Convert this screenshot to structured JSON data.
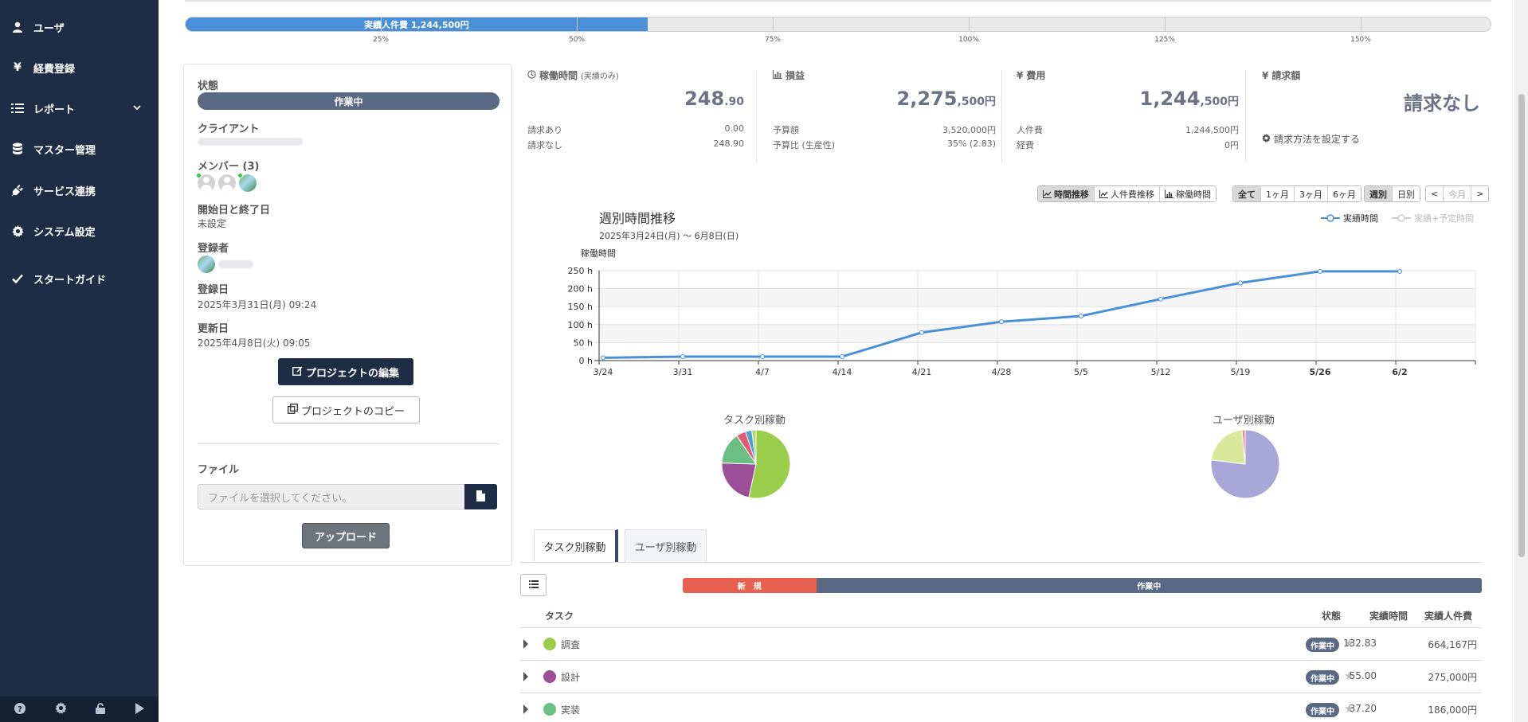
{
  "sidebar": {
    "items": [
      {
        "label": "ユーザ",
        "icon": "user-icon"
      },
      {
        "label": "経費登録",
        "icon": "yen-icon"
      },
      {
        "label": "レポート",
        "icon": "list-icon"
      },
      {
        "label": "マスター管理",
        "icon": "database-icon"
      },
      {
        "label": "サービス連携",
        "icon": "plug-icon"
      },
      {
        "label": "システム設定",
        "icon": "gear-icon"
      },
      {
        "label": "スタートガイド",
        "icon": "check-icon"
      }
    ]
  },
  "budget_bar": {
    "label": "実績人件費 1,244,500円",
    "fill_fraction": 0.354,
    "ticks": [
      "25%",
      "50%",
      "75%",
      "100%",
      "125%",
      "150%"
    ]
  },
  "info": {
    "status_label": "状態",
    "status_value": "作業中",
    "client_label": "クライアント",
    "members_label": "メンバー (3)",
    "dates_label": "開始日と終了日",
    "dates_value": "未設定",
    "registrant_label": "登録者",
    "registered_label": "登録日",
    "registered_value": "2025年3月31日(月) 09:24",
    "updated_label": "更新日",
    "updated_value": "2025年4月8日(火) 09:05",
    "edit_button": "プロジェクトの編集",
    "copy_button": "プロジェクトのコピー",
    "file_label": "ファイル",
    "file_placeholder": "ファイルを選択してください。",
    "upload_button": "アップロード"
  },
  "stats": {
    "hours": {
      "title": "稼働時間",
      "title_note": "(実績のみ)",
      "big_main": "248",
      "big_sub": ".90",
      "rows": [
        {
          "k": "請求あり",
          "v": "0.00"
        },
        {
          "k": "請求なし",
          "v": "248.90"
        }
      ]
    },
    "profit": {
      "title": "損益",
      "big_main": "2,275",
      "big_sub": ",500円",
      "rows": [
        {
          "k": "予算額",
          "v": "3,520,000円"
        },
        {
          "k": "予算比 (生産性)",
          "v": "35% (2.83)"
        }
      ]
    },
    "cost": {
      "title": "費用",
      "big_main": "1,244",
      "big_sub": ",500円",
      "rows": [
        {
          "k": "人件費",
          "v": "1,244,500円"
        },
        {
          "k": "経費",
          "v": "0円"
        }
      ]
    },
    "billing": {
      "title": "請求額",
      "big": "請求なし",
      "link": "請求方法を設定する"
    }
  },
  "toolbar": {
    "views": [
      "時間推移",
      "人件費推移",
      "稼働時間"
    ],
    "ranges": [
      "全て",
      "1ヶ月",
      "3ヶ月",
      "6ヶ月"
    ],
    "grain": [
      "週別",
      "日別"
    ],
    "nav": [
      "<",
      "今月",
      ">"
    ]
  },
  "chart_data": {
    "type": "line",
    "title": "週別時間推移",
    "subtitle": "2025年3月24日(月) 〜 6月8日(日)",
    "ylabel": "稼働時間",
    "ylim": [
      0,
      250
    ],
    "yticks": [
      "0 h",
      "50 h",
      "100 h",
      "150 h",
      "200 h",
      "250 h"
    ],
    "categories": [
      "3/24",
      "3/31",
      "4/7",
      "4/14",
      "4/21",
      "4/28",
      "5/5",
      "5/12",
      "5/19",
      "5/26",
      "6/2"
    ],
    "bold_categories": [
      "5/26",
      "6/2"
    ],
    "series": [
      {
        "name": "実績時間",
        "values": [
          8,
          11,
          11,
          11,
          78,
          108,
          124,
          171,
          216,
          248,
          248
        ],
        "color": "#4a90d9"
      },
      {
        "name": "実績+予定時間",
        "values": [],
        "color": "#cccccc"
      }
    ]
  },
  "pies": {
    "task_title": "タスク別稼動",
    "user_title": "ユーザ別稼動",
    "task": [
      {
        "value": 53.4,
        "color": "#9acd4a"
      },
      {
        "value": 22.1,
        "color": "#9b4f96"
      },
      {
        "value": 15.0,
        "color": "#6cbf84"
      },
      {
        "value": 4.5,
        "color": "#e05a77"
      },
      {
        "value": 3.0,
        "color": "#4b9fd5"
      },
      {
        "value": 2.0,
        "color": "#b9d46a"
      }
    ],
    "user": [
      {
        "value": 77.0,
        "color": "#a9a6d8"
      },
      {
        "value": 21.5,
        "color": "#d9e89a"
      },
      {
        "value": 1.5,
        "color": "#e48aa0"
      }
    ]
  },
  "tabs": [
    "タスク別稼動",
    "ユーザ別稼動"
  ],
  "status_bar": [
    {
      "label": "新　規",
      "fraction": 0.167,
      "color": "#e8604f"
    },
    {
      "label": "作業中",
      "fraction": 0.833,
      "color": "#5a6a85"
    }
  ],
  "table": {
    "headers": {
      "task": "タスク",
      "status": "状態",
      "hours": "実績時間",
      "cost": "実績人件費"
    },
    "rows": [
      {
        "name": "調査",
        "color": "#9acd4a",
        "status": "作業中",
        "hours": "132.83",
        "cost": "664,167円"
      },
      {
        "name": "設計",
        "color": "#9b4f96",
        "status": "作業中",
        "hours": "55.00",
        "cost": "275,000円"
      },
      {
        "name": "実装",
        "color": "#6cbf84",
        "status": "作業中",
        "hours": "37.20",
        "cost": "186,000円"
      }
    ]
  }
}
